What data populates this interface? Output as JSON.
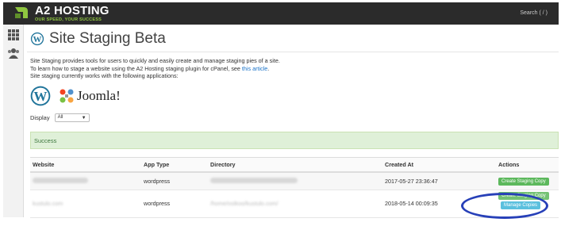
{
  "header": {
    "brand": "A2 HOSTING",
    "tagline": "OUR SPEED, YOUR SUCCESS",
    "search": "Search ( / )",
    "brand_color": "#8fc540"
  },
  "rail": {
    "items": [
      {
        "icon": "grid-icon"
      },
      {
        "icon": "users-icon"
      }
    ]
  },
  "page": {
    "title": "Site Staging Beta",
    "title_icon": "wordpress-icon",
    "intro_line1": "Site Staging provides tools for users to quickly and easily create and manage staging pies of a site.",
    "intro_line2_prefix": "To learn how to stage a website using the A2 Hosting staging plugin for cPanel, see ",
    "intro_link": "this article",
    "intro_line2_suffix": ".",
    "intro_line3": "Site staging currently works with the following applications:",
    "apps": [
      "wordpress-logo",
      "joomla-logo"
    ],
    "joomla_text": "Joomla!",
    "display_label": "Display",
    "display_value": "All",
    "alert": "Success"
  },
  "table": {
    "headers": [
      "Website",
      "App Type",
      "Directory",
      "Created At",
      "Actions"
    ],
    "rows": [
      {
        "website": "",
        "app_type": "wordpress",
        "directory": "",
        "created_at": "2017-05-27 23:36:47",
        "actions": [
          "Create Staging Copy"
        ]
      },
      {
        "website": "kustulo.com",
        "app_type": "wordpress",
        "directory": "/home/ostkoo/kustulo.com/",
        "created_at": "2018-05-14 00:09:35",
        "actions": [
          "Create Staging Copy",
          "Manage Copies"
        ]
      }
    ]
  },
  "colors": {
    "topbar": "#2b2b2b",
    "success_bg": "#dff0d8",
    "button_green": "#5cb85c",
    "button_blue": "#5bc0de",
    "highlight": "#2740b8"
  }
}
